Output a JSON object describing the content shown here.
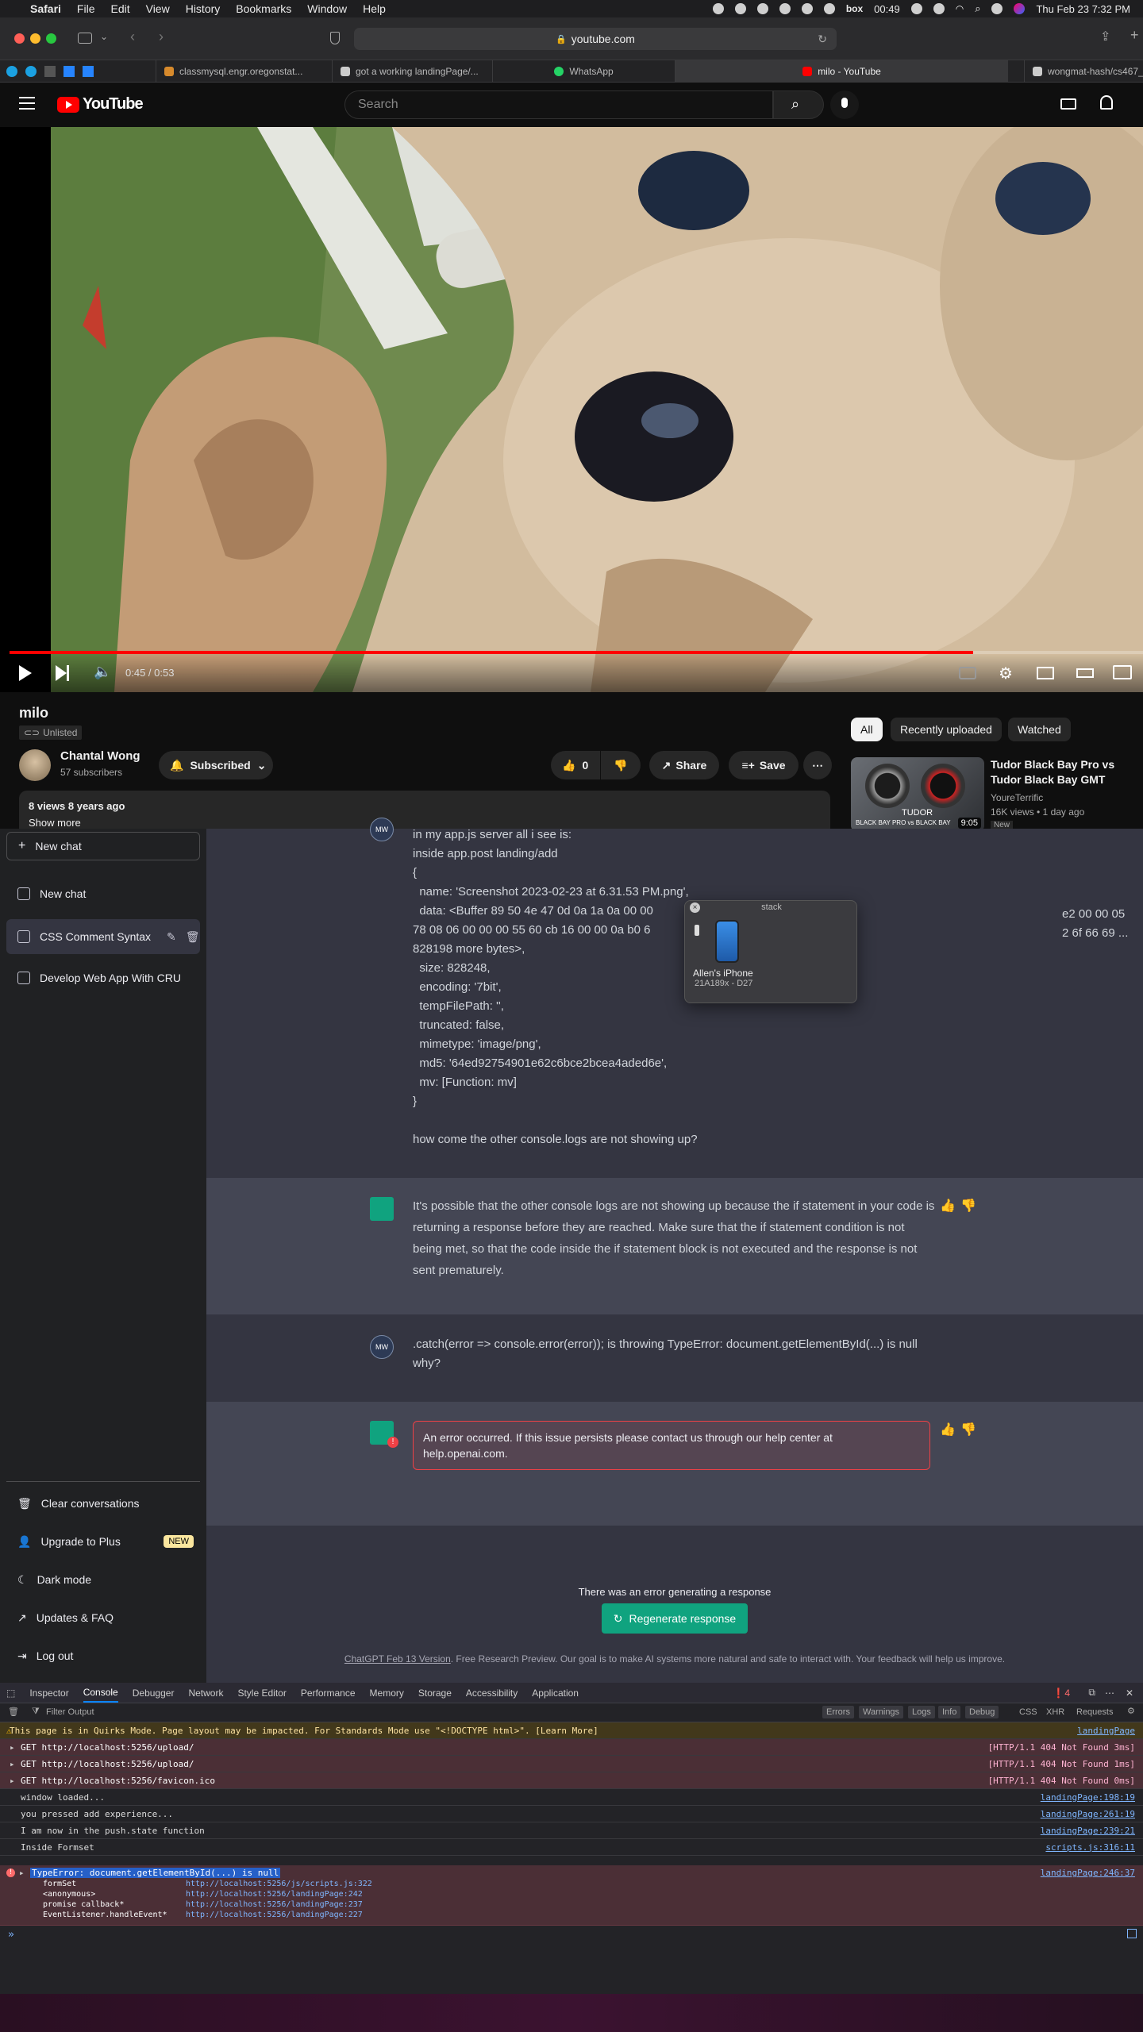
{
  "menubar": {
    "app": "Safari",
    "items": [
      "File",
      "Edit",
      "View",
      "History",
      "Bookmarks",
      "Window",
      "Help"
    ],
    "timer": "00:49",
    "clock": "Thu Feb 23  7:32 PM"
  },
  "safari": {
    "address": "youtube.com"
  },
  "tabs": [
    {
      "label": "classmysql.engr.oregonstat...",
      "color": "#d78a2c"
    },
    {
      "label": "got a working landingPage/...",
      "color": "#cccccc"
    },
    {
      "label": "WhatsApp",
      "color": "#25d366"
    },
    {
      "label": "milo - YouTube",
      "color": "#ff0000"
    },
    {
      "label": "wongmat-hash/cs467_...",
      "color": "#cccccc"
    }
  ],
  "youtube": {
    "logo": "YouTube",
    "search_placeholder": "Search",
    "time": "0:45 / 0:53",
    "progress": 0.85,
    "title": "milo",
    "unlisted": "Unlisted",
    "channel": "Chantal Wong",
    "subscribers": "57 subscribers",
    "subscribed": "Subscribed",
    "likes": "0",
    "share": "Share",
    "save": "Save",
    "desc_meta": "8 views  8 years ago",
    "show_more": "Show more",
    "chips": [
      "All",
      "Recently uploaded",
      "Watched"
    ],
    "rec": {
      "title": "Tudor Black Bay Pro vs Tudor Black Bay GMT",
      "channel": "YoureTerrific",
      "meta": "16K views  •  1 day ago",
      "badge": "New",
      "duration": "9:05",
      "thumb_text": "TUDOR",
      "thumb_sub": "BLACK BAY PRO vs BLACK BAY"
    }
  },
  "chatgpt": {
    "sidebar": {
      "new_chat_btn": "New chat",
      "items": [
        "New chat",
        "CSS Comment Syntax",
        "Develop Web App With CRU"
      ],
      "bottom": [
        "Clear conversations",
        "Upgrade to Plus",
        "Dark mode",
        "Updates & FAQ",
        "Log out"
      ],
      "new_badge": "NEW"
    },
    "user_msg1_lines": [
      "in my app.js server all i see is:",
      "inside app.post landing/add",
      "{",
      "  name: 'Screenshot 2023-02-23 at 6.31.53 PM.png',",
      "  data: <Buffer 89 50 4e 47 0d 0a 1a 0a 00 00",
      "78 08 06 00 00 00 55 60 cb 16 00 00 0a b0 6",
      "828198 more bytes>,",
      "  size: 828248,",
      "  encoding: '7bit',",
      "  tempFilePath: '',",
      "  truncated: false,",
      "  mimetype: 'image/png',",
      "  md5: '64ed92754901e62c6bce2bcea4aded6e',",
      "  mv: [Function: mv]",
      "}",
      "",
      "how come the other console.logs are not showing up?"
    ],
    "buffer_tail1": "e2 00 00 05",
    "buffer_tail2": "2 6f 66 69 ...",
    "ai_msg1": "It's possible that the other console logs are not showing up because the if statement in your code is returning a response before they are reached. Make sure that the if statement condition is not being met, so that the code inside the if statement block is not executed and the response is not sent prematurely.",
    "user_msg2": ".catch(error => console.error(error)); is throwing TypeError: document.getElementById(...) is null why?",
    "error_msg": "An error occurred. If this issue persists please contact us through our help center at help.openai.com.",
    "gen_error": "There was an error generating a response",
    "regen": "Regenerate response",
    "footer_link": "ChatGPT Feb 13 Version",
    "footer_text": ". Free Research Preview. Our goal is to make AI systems more natural and safe to interact with. Your feedback will help us improve.",
    "user_initials": "MW"
  },
  "popup": {
    "title": "stack",
    "device": "Allen's iPhone",
    "sub": "21A189x - D27"
  },
  "devtools": {
    "tabs": [
      "Inspector",
      "Console",
      "Debugger",
      "Network",
      "Style Editor",
      "Performance",
      "Memory",
      "Storage",
      "Accessibility",
      "Application"
    ],
    "error_count": "4",
    "filter_placeholder": "Filter Output",
    "filters": [
      "Errors",
      "Warnings",
      "Logs",
      "Info",
      "Debug"
    ],
    "filters2": [
      "CSS",
      "XHR",
      "Requests"
    ],
    "quirks": "This page is in Quirks Mode. Page layout may be impacted. For Standards Mode use \"<!DOCTYPE html>\". [Learn More]",
    "quirks_src": "landingPage",
    "gets": [
      {
        "url": "GET http://localhost:5256/upload/",
        "status": "[HTTP/1.1 404 Not Found 3ms]"
      },
      {
        "url": "GET http://localhost:5256/upload/",
        "status": "[HTTP/1.1 404 Not Found 1ms]"
      },
      {
        "url": "GET http://localhost:5256/favicon.ico",
        "status": "[HTTP/1.1 404 Not Found 0ms]"
      }
    ],
    "logs": [
      {
        "text": "window loaded...",
        "src": "landingPage:198:19"
      },
      {
        "text": "you pressed add experience...",
        "src": "landingPage:261:19"
      },
      {
        "text": "I am now in the push.state function",
        "src": "landingPage:239:21"
      },
      {
        "text": "Inside Formset",
        "src": "scripts.js:316:11"
      }
    ],
    "error": {
      "text": "TypeError: document.getElementById(...) is null",
      "src": "landingPage:246:37",
      "stack": [
        {
          "fn": "formSet",
          "loc": "http://localhost:5256/js/scripts.js:322"
        },
        {
          "fn": "<anonymous>",
          "loc": "http://localhost:5256/landingPage:242"
        },
        {
          "fn": "promise callback*",
          "loc": "http://localhost:5256/landingPage:237"
        },
        {
          "fn": "EventListener.handleEvent*",
          "loc": "http://localhost:5256/landingPage:227"
        }
      ]
    },
    "prompt": "»"
  }
}
